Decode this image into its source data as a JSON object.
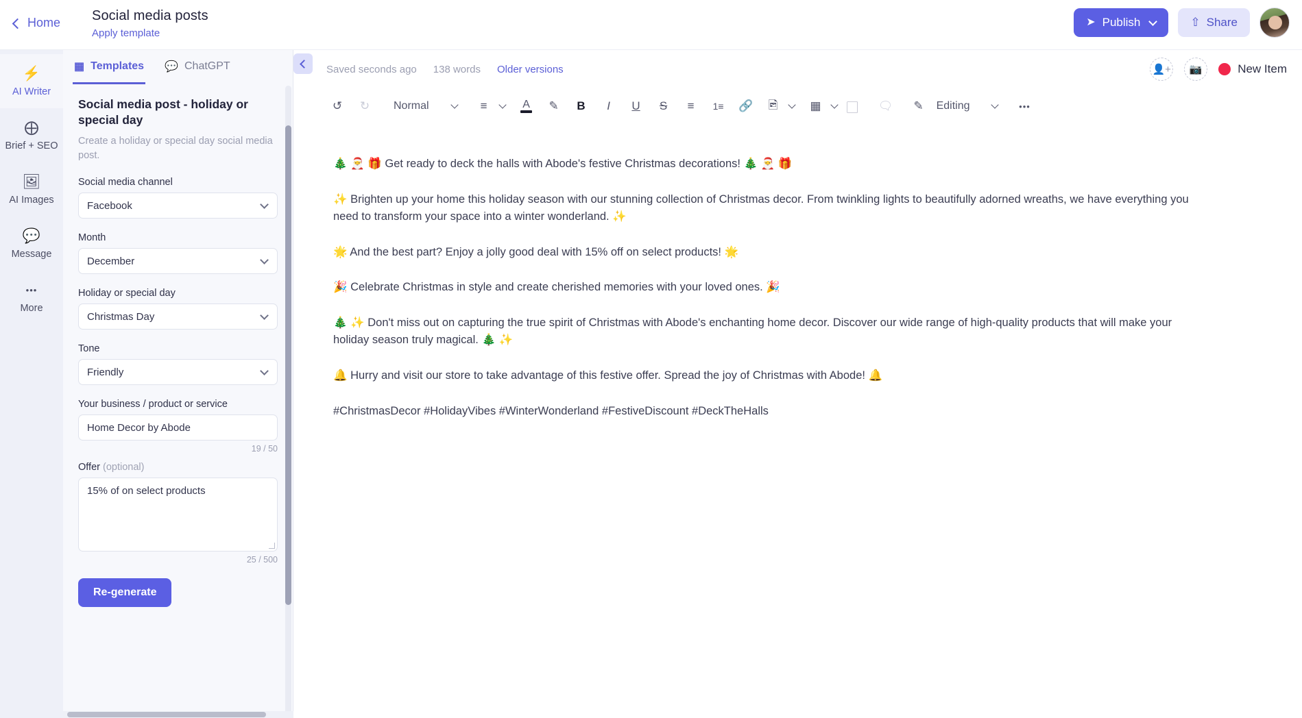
{
  "topbar": {
    "home_label": "Home",
    "doc_title": "Social media posts",
    "apply_template_label": "Apply template",
    "publish_label": "Publish",
    "publish_icon": "send-icon",
    "share_label": "Share",
    "share_icon": "upload-icon",
    "accent_color": "#5b5fe3"
  },
  "rail": {
    "items": [
      {
        "label": "AI Writer",
        "icon": "lightning-bolt-icon",
        "glyph": "⚡",
        "active": true
      },
      {
        "label": "Brief + SEO",
        "icon": "target-icon",
        "glyph": "⨁",
        "active": false
      },
      {
        "label": "AI Images",
        "icon": "image-icon",
        "glyph": "🖼",
        "active": false
      },
      {
        "label": "Message",
        "icon": "chat-bubble-icon",
        "glyph": "💬",
        "active": false
      },
      {
        "label": "More",
        "icon": "ellipsis-icon",
        "glyph": "•••",
        "active": false
      }
    ]
  },
  "panel": {
    "tabs": [
      {
        "label": "Templates",
        "icon": "grid-icon",
        "glyph": "▦",
        "active": true
      },
      {
        "label": "ChatGPT",
        "icon": "chat-icon",
        "glyph": "💬",
        "active": false
      }
    ],
    "template_name": "Social media post - holiday or special day",
    "template_desc": "Create a holiday or special day social media post.",
    "fields": [
      {
        "label": "Social media channel",
        "type": "select",
        "value": "Facebook",
        "name": "social-media-channel"
      },
      {
        "label": "Month",
        "type": "select",
        "value": "December",
        "name": "month"
      },
      {
        "label": "Holiday or special day",
        "type": "select",
        "value": "Christmas Day",
        "name": "holiday-or-special-day"
      },
      {
        "label": "Tone",
        "type": "select",
        "value": "Friendly",
        "name": "tone"
      },
      {
        "label": "Your business / product or service",
        "type": "text",
        "value": "Home Decor by Abode",
        "counter": "19 / 50",
        "name": "business-product-service"
      },
      {
        "label": "Offer",
        "optional": "(optional)",
        "type": "textarea",
        "value": "15% of on select products",
        "counter": "25 / 500",
        "name": "offer"
      }
    ],
    "regenerate_label": "Re-generate"
  },
  "editor": {
    "status": {
      "saved_text": "Saved seconds ago",
      "word_count": "138 words",
      "older_versions_label": "Older versions",
      "add_person_icon": "add-person-icon",
      "add_image_icon": "add-image-icon",
      "new_item_label": "New Item",
      "new_item_color": "#f0274b"
    },
    "toolbar": {
      "undo": "undo-icon",
      "redo": "redo-icon",
      "style_label": "Normal",
      "align_icon": "align-icon",
      "text_color_icon": "text-color-icon",
      "highlight_icon": "highlighter-icon",
      "bold": "B",
      "italic": "I",
      "underline": "U",
      "strikethrough": "S",
      "bullet_list_icon": "bullet-list-icon",
      "numbered_list_icon": "numbered-list-icon",
      "link_icon": "link-icon",
      "image_icon": "image-icon",
      "table_icon": "table-icon",
      "clear_format_icon": "clear-formatting-icon",
      "comment_icon": "comment-icon",
      "mode_icon": "pencil-icon",
      "mode_label": "Editing",
      "more_icon": "ellipsis-icon"
    },
    "document": {
      "paragraphs": [
        "🎄 🎅 🎁 Get ready to deck the halls with Abode's festive Christmas decorations! 🎄 🎅 🎁",
        "✨ Brighten up your home this holiday season with our stunning collection of Christmas decor. From twinkling lights to beautifully adorned wreaths, we have everything you need to transform your space into a winter wonderland. ✨",
        "🌟 And the best part? Enjoy a jolly good deal with 15% off on select products! 🌟",
        "🎉 Celebrate Christmas in style and create cherished memories with your loved ones. 🎉",
        "🎄 ✨ Don't miss out on capturing the true spirit of Christmas with Abode's enchanting home decor. Discover our wide range of high-quality products that will make your holiday season truly magical. 🎄 ✨",
        "🔔 Hurry and visit our store to take advantage of this festive offer. Spread the joy of Christmas with Abode! 🔔",
        "#ChristmasDecor #HolidayVibes #WinterWonderland #FestiveDiscount #DeckTheHalls"
      ]
    }
  }
}
